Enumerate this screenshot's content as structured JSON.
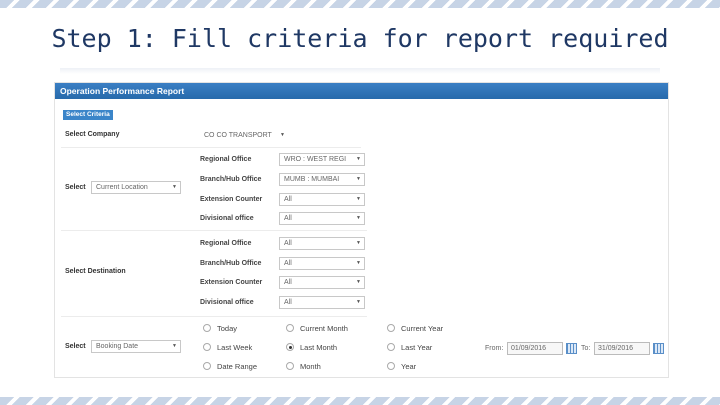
{
  "slide": {
    "title": "Step 1: Fill criteria for report required"
  },
  "report": {
    "header": "Operation Performance Report",
    "criteria_tag": "Select Criteria",
    "company": {
      "label": "Select Company",
      "value": "CO CO TRANSPORT"
    },
    "select_label": "Select",
    "location_select": "Current Location",
    "origin_rows": [
      {
        "label": "Regional Office",
        "value": "WRO : WEST REGI"
      },
      {
        "label": "Branch/Hub Office",
        "value": "MUMB : MUMBAI"
      },
      {
        "label": "Extension Counter",
        "value": "All"
      },
      {
        "label": "Divisional office",
        "value": "All"
      }
    ],
    "destination": {
      "label": "Select Destination"
    },
    "destination_rows": [
      {
        "label": "Regional Office",
        "value": "All"
      },
      {
        "label": "Branch/Hub Office",
        "value": "All"
      },
      {
        "label": "Extension Counter",
        "value": "All"
      },
      {
        "label": "Divisional office",
        "value": "All"
      }
    ],
    "date": {
      "select_label": "Select",
      "type_select": "Booking Date",
      "options": [
        "Today",
        "Current Month",
        "Current Year",
        "Last Week",
        "Last Month",
        "Last Year",
        "Date Range",
        "Month",
        "Year"
      ],
      "selected": "Last Month",
      "from_label": "From:",
      "from_value": "01/09/2016",
      "to_label": "To:",
      "to_value": "31/09/2016"
    }
  },
  "icons": {
    "calendar": "calendar-icon",
    "dropdown": "chevron-down-icon"
  },
  "colors": {
    "header": "#2f74b8",
    "title": "#1f3864",
    "stripe": "#c7d4e6"
  }
}
